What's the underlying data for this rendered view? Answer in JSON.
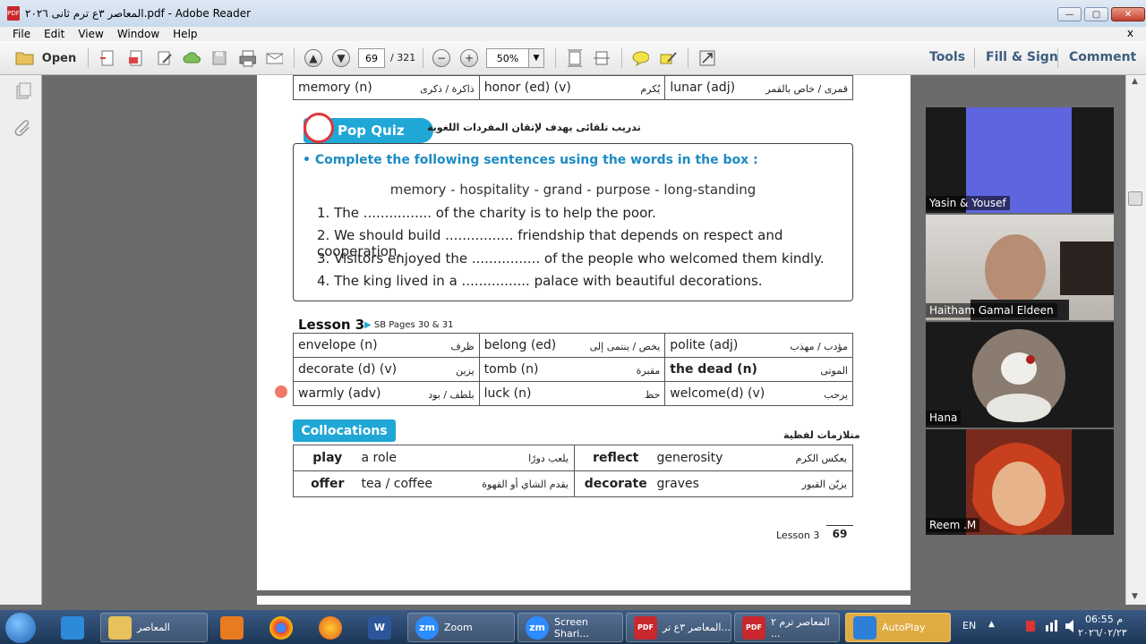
{
  "window": {
    "title": "المعاصر ٣ع ترم ثانى ٢٠٢٦.pdf - Adobe Reader",
    "pdf_badge": "PDF",
    "minimize": "—",
    "maximize": "▢",
    "close": "✕"
  },
  "menu": {
    "items": [
      "File",
      "Edit",
      "View",
      "Window",
      "Help"
    ],
    "close": "x"
  },
  "toolbar": {
    "open_label": "Open",
    "page_current": "69",
    "page_total": "/ 321",
    "zoom_value": "50%",
    "zoom_drop": "▼",
    "up": "▲",
    "down": "▼",
    "zoom_out": "−",
    "zoom_in": "+",
    "tools": "Tools",
    "fill_sign": "Fill & Sign",
    "comment": "Comment"
  },
  "document": {
    "top_row": [
      {
        "en": "memory (n)",
        "ar": "ذاكرة / ذكرى"
      },
      {
        "en": "honor (ed) (v)",
        "ar": "يُكرم"
      },
      {
        "en": "lunar (adj)",
        "ar": "قمرى / خاص بالقمر"
      }
    ],
    "pop_quiz": {
      "badge": "Pop Quiz",
      "arabic": "تدريب تلقائى يهدف لإتقان المفردات اللغوية",
      "instruction": "• Complete the following sentences using the words in the box :",
      "words": "memory - hospitality - grand - purpose - long-standing",
      "sentences": [
        "1. The ................ of the charity is to help the poor.",
        "2. We should build ................ friendship that depends on respect and cooperation.",
        "3. Visitors enjoyed the ................ of the people who welcomed them kindly.",
        "4. The king lived in a ................ palace with beautiful decorations."
      ]
    },
    "lesson": {
      "title": "Lesson 3",
      "sb_marker": "▶",
      "sb_pages": "SB Pages 30 & 31",
      "rows": [
        [
          {
            "en": "envelope (n)",
            "ar": "ظرف"
          },
          {
            "en": "belong (ed)",
            "ar": "يخص / ينتمى إلى"
          },
          {
            "en": "polite (adj)",
            "ar": "مؤدب / مهذب"
          }
        ],
        [
          {
            "en": "decorate (d) (v)",
            "ar": "يزين"
          },
          {
            "en": "tomb (n)",
            "ar": "مقبرة"
          },
          {
            "en": "the dead (n)",
            "ar": "الموتى"
          }
        ],
        [
          {
            "en": "warmly (adv)",
            "ar": "بلطف / بود"
          },
          {
            "en": "luck (n)",
            "ar": "حظ"
          },
          {
            "en": "welcome(d) (v)",
            "ar": "يرحب"
          }
        ]
      ]
    },
    "collocations": {
      "badge": "Collocations",
      "arabic": "متلازمات لفظية",
      "rows": [
        {
          "v1": "play",
          "o1": "a role",
          "a1": "يلعب دورًا",
          "v2": "reflect",
          "o2": "generosity",
          "a2": "يعكس الكرم"
        },
        {
          "v1": "offer",
          "o1": "tea / coffee",
          "a1": "يقدم الشاي أو القهوة",
          "v2": "decorate",
          "o2": "graves",
          "a2": "يزيّن القبور"
        }
      ]
    },
    "footer": {
      "lesson": "Lesson 3",
      "page": "69"
    }
  },
  "participants": [
    {
      "name": "Yasin & Yousef"
    },
    {
      "name": "Haitham Gamal Eldeen"
    },
    {
      "name": "Hana"
    },
    {
      "name": "Reem .M"
    }
  ],
  "taskbar": {
    "apps": [
      {
        "label": "المعاصر"
      },
      {
        "label": "Zoom"
      },
      {
        "label": "Screen Shari..."
      },
      {
        "label": "المعاصر ٣ع تر..."
      },
      {
        "label": "المعاصر ترم ٢ ..."
      },
      {
        "label": "AutoPlay"
      }
    ],
    "icons": {
      "zoom": "zm",
      "word": "W",
      "pdf": "PDF"
    },
    "lang": "EN",
    "time": "06:55 م",
    "date": "٢٠٢٦/٠٢/٢٣"
  },
  "colors": {
    "accent_blue": "#1fa7d6",
    "instruction_blue": "#1e8bc3",
    "adobe_link": "#3d5d7e",
    "clock_red": "#e3343a"
  }
}
